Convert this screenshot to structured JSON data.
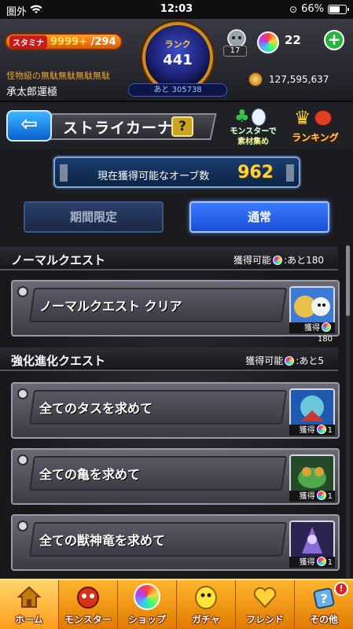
{
  "status_bar": {
    "carrier": "圏外",
    "time": "12:03",
    "battery": "66%",
    "battery_level": 0.66
  },
  "top_bar": {
    "stamina_label": "スタミナ",
    "stamina_current": "9999+",
    "stamina_max": "/294",
    "rank_label": "ランク",
    "rank_value": "441",
    "rank_next": "あと 305738",
    "helper_count": "17",
    "orb_count": "22",
    "orb_add": "+",
    "quest_title": "怪物級の無駄無駄無駄無駄",
    "player_name": "承太郎運極",
    "coins": "127,595,637"
  },
  "header": {
    "back": "⇦",
    "title": "ストライカーナビ",
    "help": "?",
    "monster_material_line1": "モンスターで",
    "monster_material_line2": "素材集め",
    "ranking": "ランキング"
  },
  "orb_panel": {
    "label": "現在獲得可能なオーブ数",
    "value": "962"
  },
  "tabs": {
    "limited": "期間限定",
    "normal": "通常"
  },
  "sections": [
    {
      "name": "ノーマルクエスト",
      "avail_prefix": "獲得可能",
      "avail_suffix": ":あと180",
      "quests": [
        {
          "label": "ノーマルクエスト クリア",
          "reward_prefix": "獲得",
          "reward_value": "180"
        }
      ]
    },
    {
      "name": "強化進化クエスト",
      "avail_prefix": "獲得可能",
      "avail_suffix": ":あと5",
      "quests": [
        {
          "label": "全てのタスを求めて",
          "reward_prefix": "獲得",
          "reward_value": "1"
        },
        {
          "label": "全ての亀を求めて",
          "reward_prefix": "獲得",
          "reward_value": "1"
        },
        {
          "label": "全ての獣神竜を求めて",
          "reward_prefix": "獲得",
          "reward_value": "1"
        }
      ]
    }
  ],
  "bottom_nav": [
    {
      "label": "ホーム",
      "icon": "home-icon"
    },
    {
      "label": "モンスター",
      "icon": "monster-icon"
    },
    {
      "label": "ショップ",
      "icon": "shop-orb-icon"
    },
    {
      "label": "ガチャ",
      "icon": "gacha-icon"
    },
    {
      "label": "フレンド",
      "icon": "friend-icon"
    },
    {
      "label": "その他",
      "icon": "other-icon",
      "badge": "!"
    }
  ],
  "colors": {
    "accent_orange": "#f08a10",
    "tab_active": "#2a62f0",
    "orb_value": "#ffd23a"
  }
}
